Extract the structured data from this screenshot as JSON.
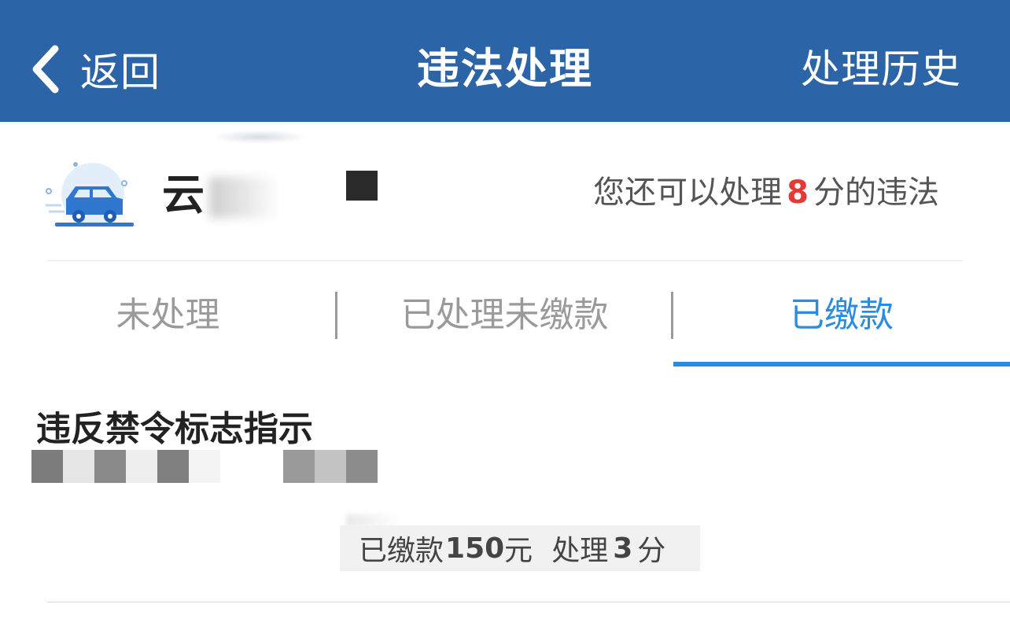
{
  "header": {
    "back_label": "返回",
    "title": "违法处理",
    "history_label": "处理历史"
  },
  "vehicle": {
    "plate_visible": "云",
    "points_prefix": "您还可以处理",
    "points_value": "8",
    "points_suffix": "分的违法"
  },
  "tabs": [
    {
      "label": "未处理",
      "active": false
    },
    {
      "label": "已处理未缴款",
      "active": false
    },
    {
      "label": "已缴款",
      "active": true
    }
  ],
  "record": {
    "title": "违反禁令标志指示",
    "status_prefix": "已缴款",
    "status_amount": "150",
    "status_unit": "元",
    "status_points_prefix": "处理",
    "status_points_value": "3",
    "status_points_unit": "分"
  },
  "colors": {
    "header_bg": "#2c64a8",
    "accent": "#2a8be0",
    "points_highlight": "#e53935"
  }
}
